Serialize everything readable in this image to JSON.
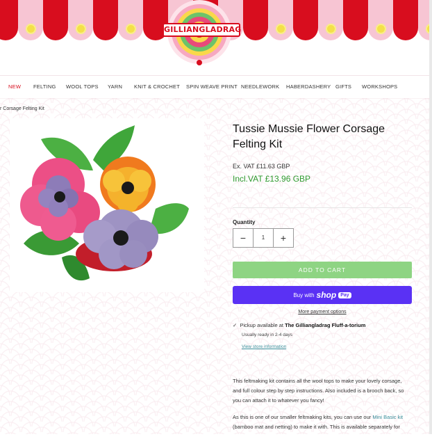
{
  "brand": {
    "name": "GILLIANGLADRAG"
  },
  "colors": {
    "awning_red": "#d80d1e",
    "awning_pink": "#f7c5d3",
    "price_green": "#2e9a2e",
    "cart_green": "#8ed483",
    "shop_purple": "#5a31f4",
    "link_teal": "#3a8f9b"
  },
  "nav": {
    "items": [
      "NEW",
      "FELTING",
      "WOOL TOPS",
      "YARN",
      "KNIT & CROCHET",
      "SPIN WEAVE PRINT",
      "NEEDLEWORK",
      "HABERDASHERY",
      "GIFTS",
      "WORKSHOPS"
    ]
  },
  "breadcrumb": {
    "text": "r Corsage Felting Kit"
  },
  "product": {
    "title": "Tussie Mussie Flower Corsage Felting Kit",
    "price_ex_vat": "Ex. VAT  £11.63 GBP",
    "price_inc_vat": "Incl.VAT  £13.96 GBP",
    "quantity_label": "Quantity",
    "quantity_value": "1",
    "add_to_cart": "ADD TO CART",
    "buy_with": "Buy with",
    "shop_word": "shop",
    "pay_badge": "Pay",
    "more_payment": "More payment options",
    "pickup_prefix": "Pickup available at",
    "pickup_location": "The Gilliangladrag Fluff-a-torium",
    "ready_text": "Usually ready in 2-4 days",
    "store_info": "View store information",
    "desc_1": "This feltmaking kit contains all the wool tops to make your lovely corsage, and full colour step by step instructions. Also included is a brooch back, so you can attach it to whatever you fancy!",
    "desc_2_pre": "As this is one of our smaller feltmaking kits, you can use our ",
    "desc_2_link": "Mini Basic kit",
    "desc_2_post": " (bamboo mat and netting) to make it with. This is available separately for"
  },
  "icons": [
    "minus-icon",
    "plus-icon",
    "check-icon"
  ]
}
